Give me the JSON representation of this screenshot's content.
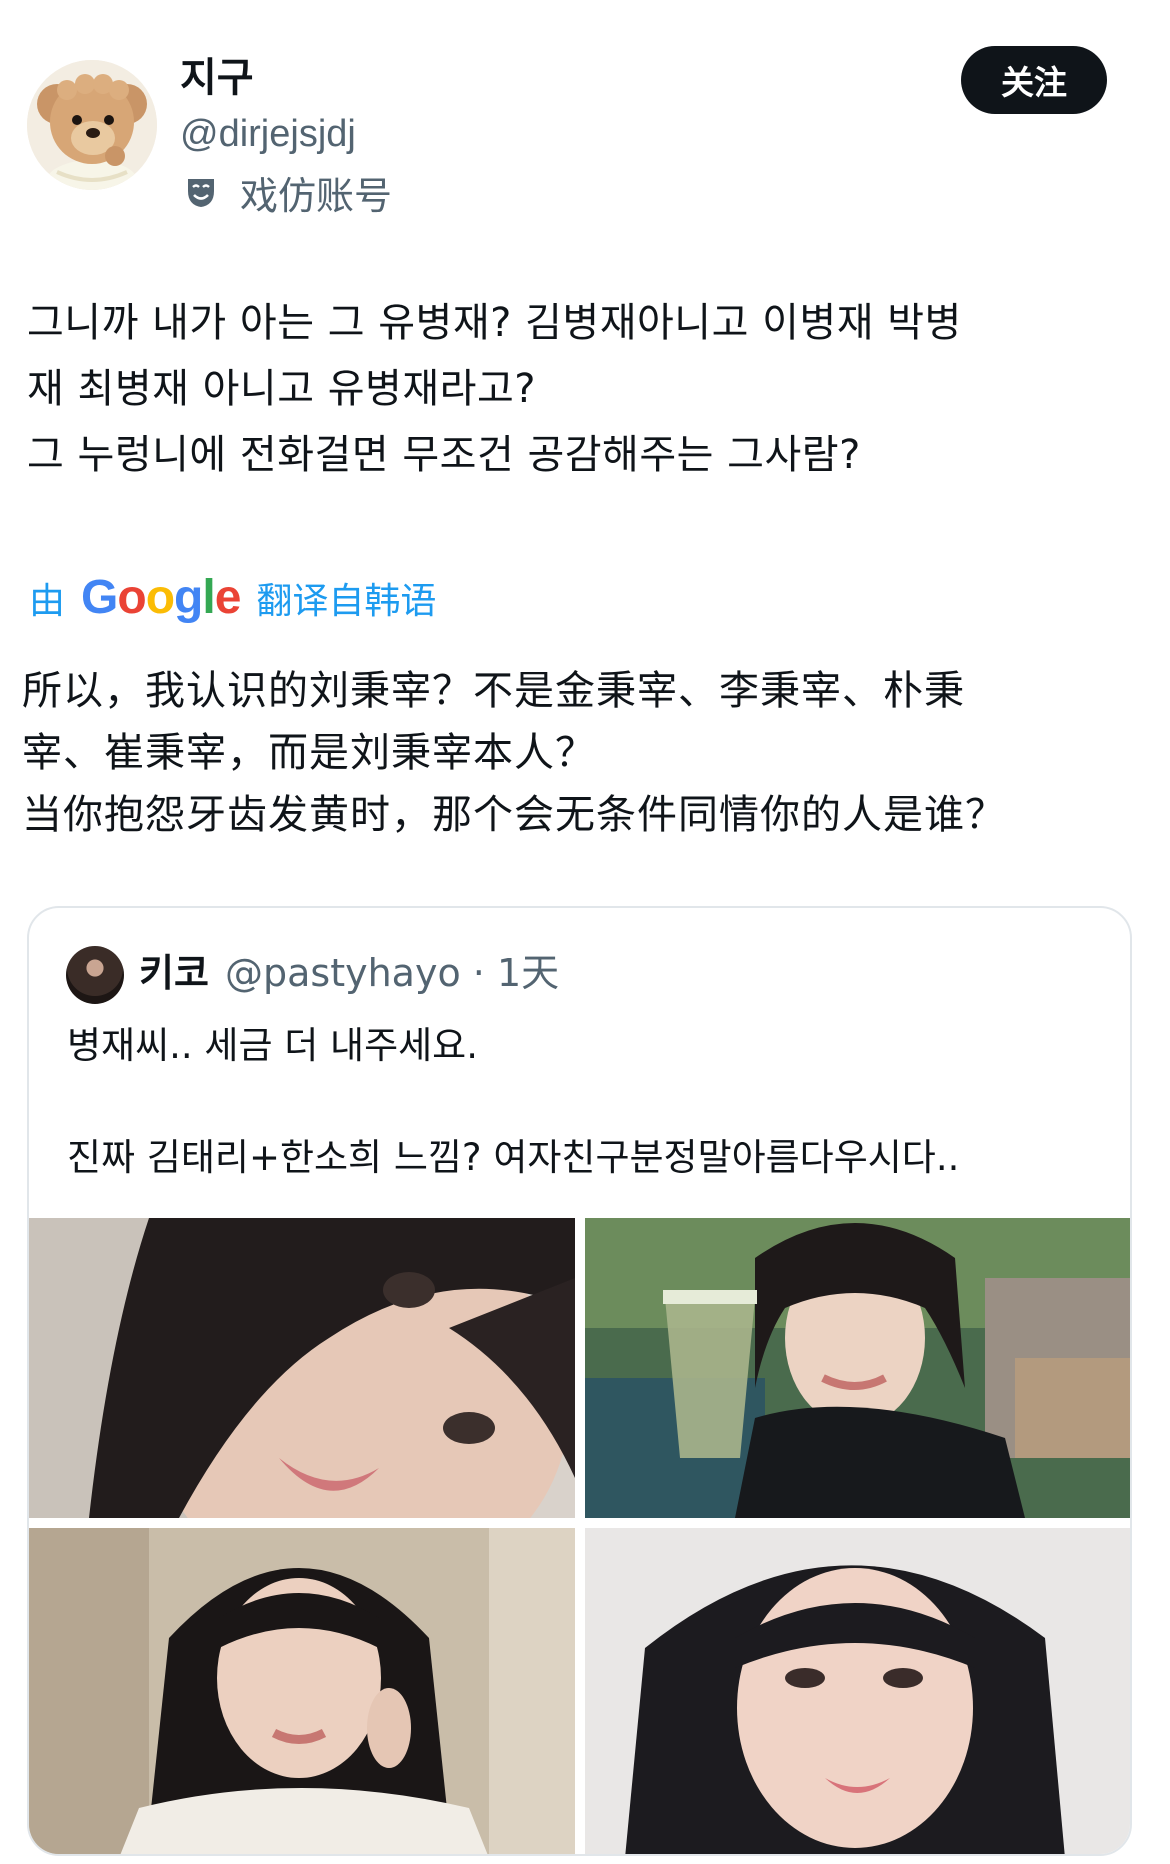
{
  "author": {
    "display_name": "지구",
    "handle": "@dirjejsjdj",
    "parody_label": "戏仿账号",
    "avatar": "teddy-bear-avatar"
  },
  "follow_label": "关注",
  "post": {
    "text": "그니까 내가 아는 그 유병재? 김병재아니고 이병재 박병\n재 최병재 아니고 유병재라고?\n그 누렁니에 전화걸면 무조건 공감해주는 그사람?"
  },
  "translation": {
    "by": "由",
    "google_letters": [
      "G",
      "o",
      "o",
      "g",
      "l",
      "e"
    ],
    "google_colors": [
      "#4285F4",
      "#EA4335",
      "#FBBC05",
      "#4285F4",
      "#34A853",
      "#EA4335"
    ],
    "label": "翻译自韩语",
    "text": "所以，我认识的刘秉宰？不是金秉宰、李秉宰、朴秉\n宰、崔秉宰，而是刘秉宰本人？\n当你抱怨牙齿发黄时，那个会无条件同情你的人是谁？"
  },
  "quote": {
    "display_name": "키코",
    "meta": "@pastyhayo · 1天",
    "text": "병재씨.. 세금 더 내주세요.\n\n진짜 김태리+한소희 느낌? 여자친구분정말아름다우시다..",
    "photos": [
      "photo-selfie-closeup",
      "photo-cafe-drink",
      "photo-white-shirt",
      "photo-portrait"
    ]
  },
  "colors": {
    "text": "#0f1419",
    "secondary": "#536471",
    "link": "#1d9bf0",
    "button_bg": "#0f1419",
    "border": "#e1e6ea"
  }
}
